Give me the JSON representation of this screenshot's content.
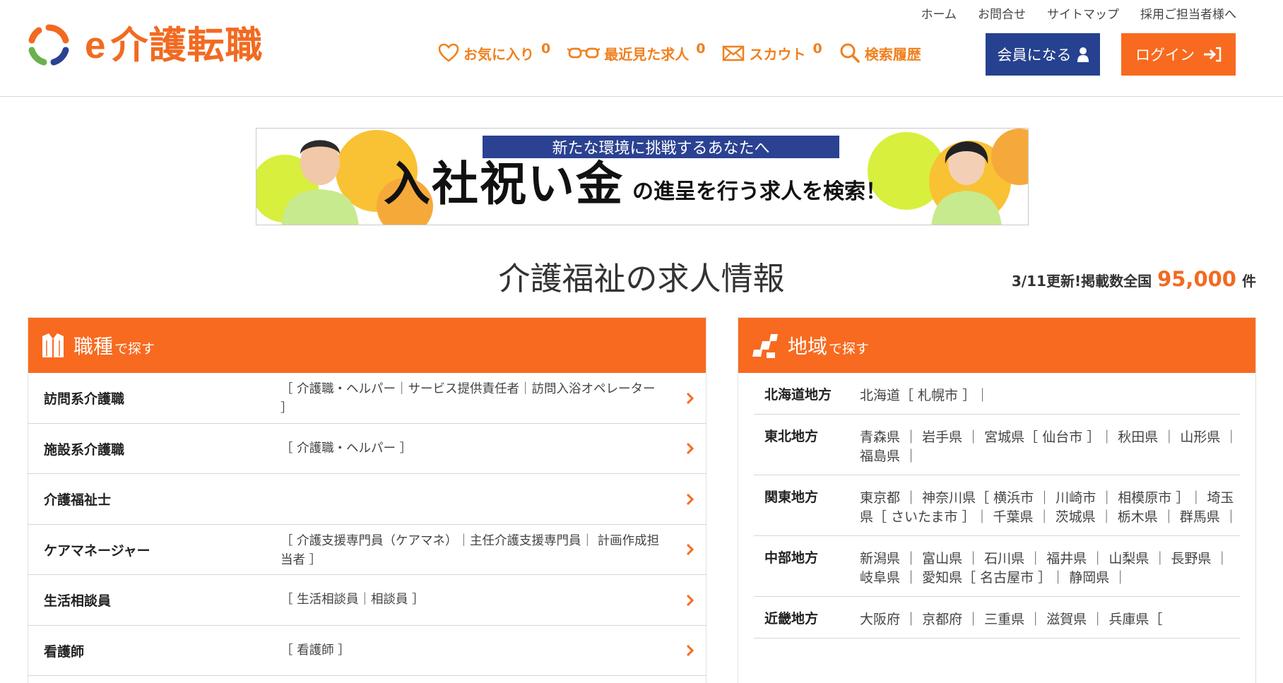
{
  "logo": {
    "e": "e",
    "name": "介護転職"
  },
  "top_links": [
    "ホーム",
    "お問合せ",
    "サイトマップ",
    "採用ご担当者様へ"
  ],
  "nav": {
    "favorites": {
      "label": "お気に入り",
      "count": "0"
    },
    "recent": {
      "label": "最近見た求人",
      "count": "0"
    },
    "scout": {
      "label": "スカウト",
      "count": "0"
    },
    "history": {
      "label": "検索履歴"
    }
  },
  "buttons": {
    "member": "会員になる",
    "login": "ログイン"
  },
  "banner": {
    "top": "新たな環境に挑戦するあなたへ",
    "big": "入社祝い金",
    "small": "の進呈を行う求人を検索！"
  },
  "page_title": "介護福祉の求人情報",
  "update": {
    "prefix": "3/11更新!掲載数全国",
    "number": "95,000",
    "suffix": "件"
  },
  "job_panel": {
    "title": "職種",
    "sub": "で探す",
    "rows": [
      {
        "name": "訪問系介護職",
        "subs": "［ 介護職・ヘルパー｜サービス提供責任者｜訪問入浴オペレーター ］"
      },
      {
        "name": "施設系介護職",
        "subs": "［ 介護職・ヘルパー ］"
      },
      {
        "name": "介護福祉士",
        "subs": ""
      },
      {
        "name": "ケアマネージャー",
        "subs": "［ 介護支援専門員（ケアマネ）｜主任介護支援専門員｜ 計画作成担当者 ］"
      },
      {
        "name": "生活相談員",
        "subs": "［ 生活相談員｜相談員 ］"
      },
      {
        "name": "看護師",
        "subs": "［ 看護師 ］"
      }
    ]
  },
  "region_panel": {
    "title": "地域",
    "sub": "で探す",
    "rows": [
      {
        "name": "北海道地方",
        "items": "北海道［ 札幌市 ］｜"
      },
      {
        "name": "東北地方",
        "items": "青森県 ｜ 岩手県 ｜ 宮城県［ 仙台市 ］｜ 秋田県 ｜ 山形県 ｜ 福島県 ｜"
      },
      {
        "name": "関東地方",
        "items": "東京都 ｜ 神奈川県［ 横浜市 ｜ 川崎市 ｜ 相模原市 ］｜ 埼玉県［ さいたま市 ］｜ 千葉県 ｜ 茨城県 ｜ 栃木県 ｜ 群馬県 ｜"
      },
      {
        "name": "中部地方",
        "items": "新潟県 ｜ 富山県 ｜ 石川県 ｜ 福井県 ｜ 山梨県 ｜ 長野県 ｜ 岐阜県 ｜ 愛知県［ 名古屋市 ］｜ 静岡県 ｜"
      },
      {
        "name": "近畿地方",
        "items": "大阪府 ｜ 京都府 ｜ 三重県 ｜ 滋賀県 ｜ 兵庫県［"
      }
    ]
  },
  "colors": {
    "orange": "#f86a1f",
    "navy": "#26418f",
    "nav_orange": "#f0801e"
  }
}
